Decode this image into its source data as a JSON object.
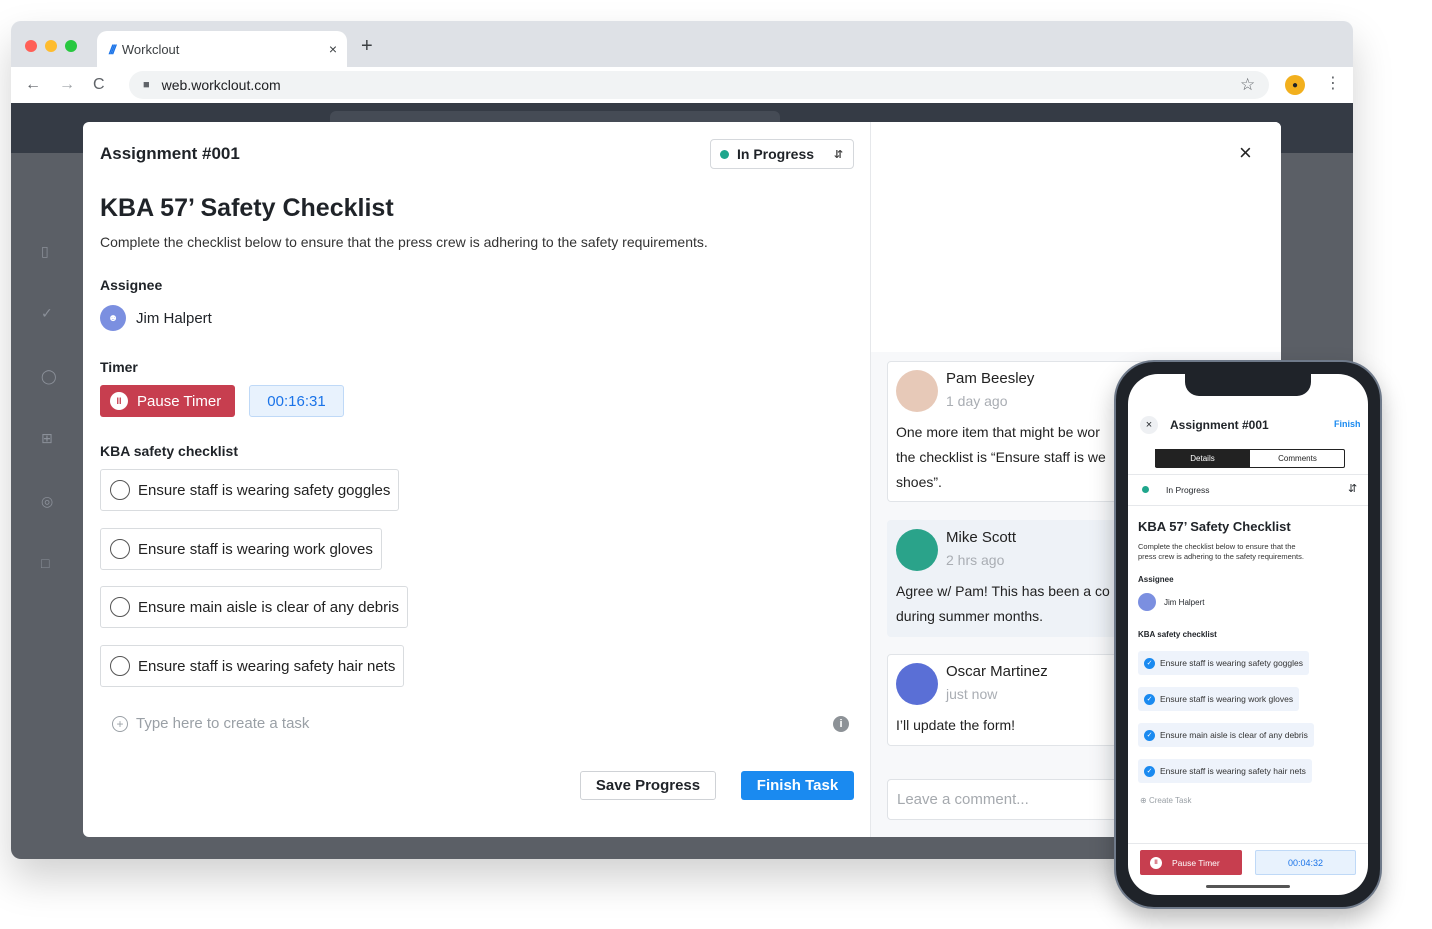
{
  "browser": {
    "tab_title": "Workclout",
    "tab_logo": "///",
    "tab_close": "×",
    "new_tab": "+",
    "url": "web.workclout.com",
    "back": "←",
    "forward": "→",
    "reload": "C",
    "star": "☆",
    "menu": "⋮"
  },
  "modal": {
    "assignment_label": "Assignment #001",
    "status": {
      "label": "In Progress",
      "color": "#1fa68c"
    },
    "close": "×",
    "title": "KBA 57’ Safety Checklist",
    "description": "Complete the checklist below  to ensure that the press crew is adhering to the safety requirements.",
    "assignee_label": "Assignee",
    "assignee_name": "Jim Halpert",
    "timer_label": "Timer",
    "pause_label": "Pause Timer",
    "timer_value": "00:16:31",
    "checklist_label": "KBA safety checklist",
    "checklist": [
      "Ensure staff is wearing safety goggles",
      "Ensure staff is wearing work gloves",
      "Ensure main aisle is clear of any debris",
      "Ensure staff is wearing safety hair nets"
    ],
    "add_task_placeholder": "Type here to create a task",
    "save_label": "Save Progress",
    "finish_label": "Finish Task"
  },
  "comments": [
    {
      "name": "Pam Beesley",
      "time": "1 day ago",
      "lines": [
        "One more item that might be wor",
        "the checklist is “Ensure staff is we",
        "shoes”."
      ]
    },
    {
      "name": "Mike Scott",
      "time": "2 hrs ago",
      "lines": [
        "Agree w/ Pam! This has been a co",
        "during summer months."
      ]
    },
    {
      "name": "Oscar Martinez",
      "time": "just now",
      "lines": [
        "I’ll update the form!"
      ]
    }
  ],
  "comment_placeholder": "Leave a comment...",
  "phone": {
    "assignment_label": "Assignment #001",
    "finish": "Finish",
    "tabs": [
      "Details",
      "Comments"
    ],
    "status": "In Progress",
    "title": "KBA 57’ Safety Checklist",
    "description_lines": [
      "Complete the checklist below  to ensure that the",
      "press crew is adhering to the safety requirements."
    ],
    "assignee_label": "Assignee",
    "assignee_name": "Jim Halpert",
    "checklist_label": "KBA safety checklist",
    "checklist": [
      "Ensure staff is wearing safety goggles",
      "Ensure staff is wearing work gloves",
      "Ensure main aisle is clear of any debris",
      "Ensure staff is wearing safety hair nets"
    ],
    "create_task": "Create Task",
    "pause_label": "Pause Timer",
    "timer_value": "00:04:32"
  }
}
